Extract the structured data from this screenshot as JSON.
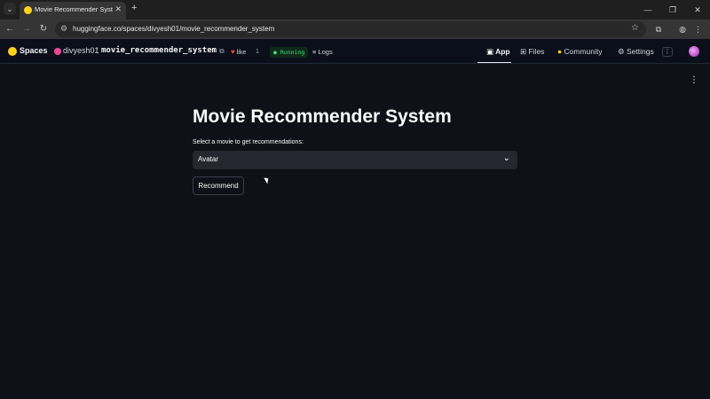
{
  "browser": {
    "tab_title": "Movie Recommender System - ",
    "url": "huggingface.co/spaces/divyesh01/movie_recommender_system"
  },
  "hf_header": {
    "brand": "Spaces",
    "owner": "divyesh01",
    "repo": "movie_recommender_system",
    "like_label": "like",
    "like_count": "1",
    "status": "Running",
    "logs_label": "Logs",
    "nav": [
      {
        "label": "App",
        "active": true
      },
      {
        "label": "Files",
        "active": false
      },
      {
        "label": "Community",
        "active": false
      },
      {
        "label": "Settings",
        "active": false
      }
    ]
  },
  "app": {
    "title": "Movie Recommender System",
    "select_label": "Select a movie to get recommendations:",
    "selected_movie": "Avatar",
    "recommend_label": "Recommend"
  },
  "colors": {
    "background": "#0e1117",
    "select_bg": "#262730",
    "hf_yellow": "#ffd21e",
    "running_green": "#4ade80"
  },
  "icons": [
    "tab-menu-icon",
    "favicon-icon",
    "close-icon",
    "plus-icon",
    "back-icon",
    "forward-icon",
    "reload-icon",
    "site-info-icon",
    "star-icon",
    "extensions-icon",
    "chevron-down-icon",
    "kebab-menu-icon",
    "heart-icon",
    "copy-icon"
  ]
}
